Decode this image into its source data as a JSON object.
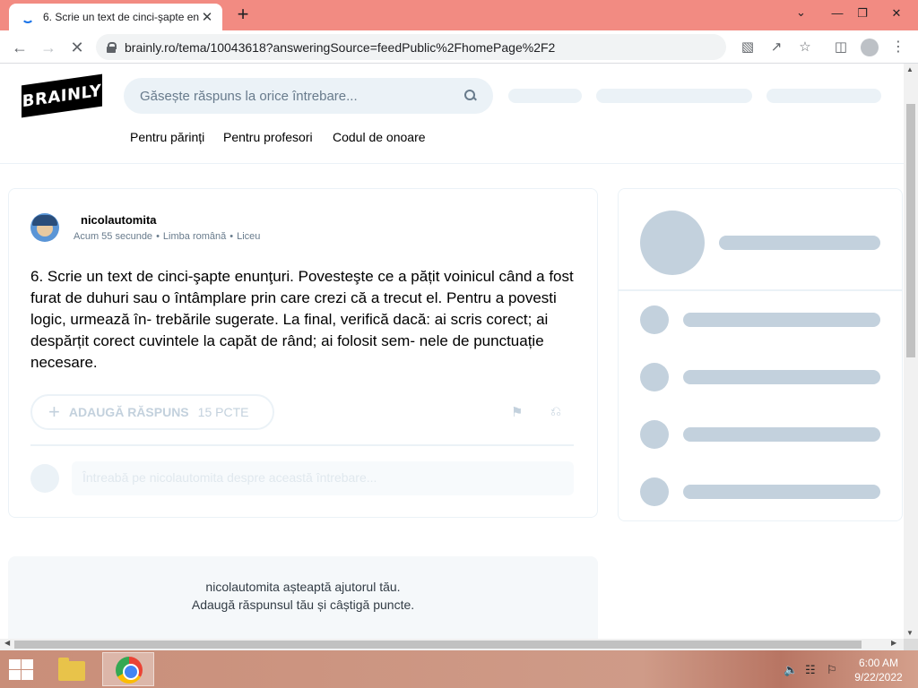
{
  "browser": {
    "tab_title": "6. Scrie un text de cinci-şapte en",
    "tab_close": "✕",
    "new_tab": "+",
    "url": "brainly.ro/tema/10043618?answeringSource=feedPublic%2FhomePage%2F2",
    "window_controls": {
      "minimize": "—",
      "maximize": "❐",
      "close": "✕",
      "tab_search": "⌄"
    },
    "icons": [
      "back-icon",
      "forward-icon",
      "stop-icon",
      "lock-icon",
      "translate-icon",
      "share-icon",
      "bookmark-star-icon",
      "side-panel-icon",
      "profile-icon",
      "menu-kebab-icon"
    ]
  },
  "site": {
    "logo": "BRAINLY",
    "search_placeholder": "Găsește răspuns la orice întrebare...",
    "nav": [
      "Pentru părinți",
      "Pentru profesori",
      "Codul de onoare"
    ]
  },
  "question": {
    "author": "nicolautomita",
    "time": "Acum 55 secunde",
    "subject": "Limba română",
    "level": "Liceu",
    "meta_sep": "•",
    "text": "6. Scrie un text de cinci-şapte enunţuri. Povesteşte ce a pățit voinicul când a fost furat de duhuri sau o întâmplare prin care crezi că a trecut el. Pentru a povesti logic, urmează în- trebările sugerate. La final, verifică dacă: ai scris corect; ai despărțit corect cuvintele la capăt de rând; ai folosit sem- nele de punctuație necesare.",
    "add_answer_label": "ADAUGĂ RĂSPUNS",
    "points_label": "15 PCTE",
    "comment_placeholder": "Întreabă pe nicolautomita despre această întrebare..."
  },
  "waiting": {
    "line1": "nicolautomita așteaptă ajutorul tău.",
    "line2": "Adaugă răspunsul tău și câștigă puncte."
  },
  "taskbar": {
    "time": "6:00 AM",
    "date": "9/22/2022",
    "pinned": [
      "start-button",
      "file-explorer",
      "chrome"
    ]
  },
  "colors": {
    "tab_strip": "#f28b82",
    "skeleton": "#ebf2f7",
    "skeleton_dark": "#c3d1dd"
  }
}
